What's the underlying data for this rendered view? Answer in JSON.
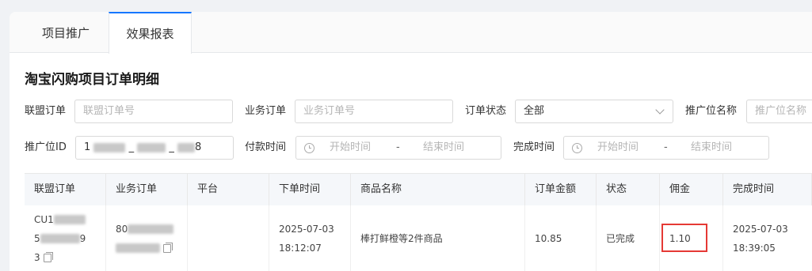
{
  "tabs": [
    {
      "label": "项目推广",
      "active": false
    },
    {
      "label": "效果报表",
      "active": true
    }
  ],
  "section_title": "淘宝闪购项目订单明细",
  "filters": {
    "union_order": {
      "label": "联盟订单",
      "placeholder": "联盟订单号"
    },
    "business_order": {
      "label": "业务订单",
      "placeholder": "业务订单号"
    },
    "order_status": {
      "label": "订单状态",
      "value": "全部"
    },
    "position_name": {
      "label": "推广位名称",
      "placeholder": "推广位名称"
    },
    "position_id": {
      "label": "推广位ID",
      "value_prefix": "1",
      "value_sep1": "_",
      "value_sep2": "_",
      "value_suffix": "8"
    },
    "pay_time": {
      "label": "付款时间",
      "start": "开始时间",
      "sep": "-",
      "end": "结束时间"
    },
    "finish_time": {
      "label": "完成时间",
      "start": "开始时间",
      "sep": "-",
      "end": "结束时间"
    }
  },
  "table": {
    "columns": [
      "联盟订单",
      "业务订单",
      "平台",
      "下单时间",
      "商品名称",
      "订单金额",
      "状态",
      "佣金",
      "完成时间"
    ],
    "rows": [
      {
        "union_order_line1": "CU1",
        "union_order_line2": "5",
        "union_order_line2_end": "9",
        "union_order_line3": "3",
        "business_order_line1": "80",
        "platform": "",
        "order_date": "2025-07-03",
        "order_time": "18:12:07",
        "product": "棒打鲜橙等2件商品",
        "amount": "10.85",
        "status": "已完成",
        "commission": "1.10",
        "finish_date": "2025-07-03",
        "finish_time": "18:39:05"
      }
    ]
  },
  "colors": {
    "accent": "#1677ff",
    "highlight": "#e53935"
  }
}
